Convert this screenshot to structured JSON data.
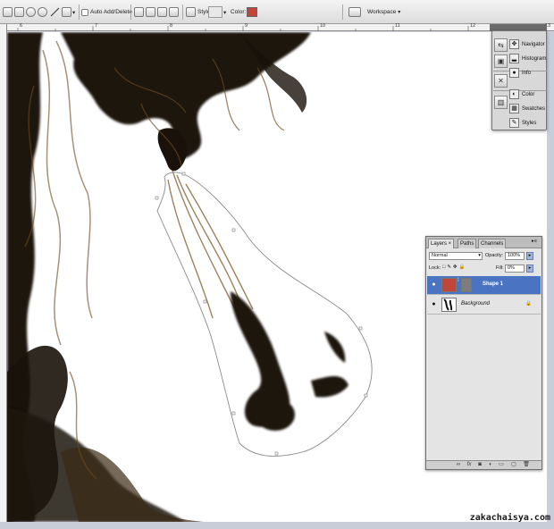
{
  "options_bar": {
    "auto_add_delete": "Auto Add/Delete",
    "style_label": "Style:",
    "color_label": "Color:",
    "color_value": "#c2453a",
    "workspace_label": "Workspace"
  },
  "ruler": {
    "h_marks": [
      "6",
      "7",
      "8",
      "9",
      "10",
      "11",
      "12",
      "13"
    ]
  },
  "dock": {
    "items": [
      {
        "label": "Navigator",
        "icon": "navigator-icon"
      },
      {
        "label": "Histogram",
        "icon": "histogram-icon"
      },
      {
        "label": "Info",
        "icon": "info-icon"
      },
      {
        "label": "Color",
        "icon": "color-icon"
      },
      {
        "label": "Swatches",
        "icon": "swatches-icon"
      },
      {
        "label": "Styles",
        "icon": "styles-icon"
      }
    ]
  },
  "layers_panel": {
    "tabs": [
      "Layers ×",
      "Paths",
      "Channels"
    ],
    "blend_mode": "Normal",
    "opacity_label": "Opacity:",
    "opacity_value": "100%",
    "lock_label": "Lock:",
    "fill_label": "Fill:",
    "fill_value": "0%",
    "layers": [
      {
        "name": "Shape 1",
        "selected": true,
        "thumb_color": "#c2453a"
      },
      {
        "name": "Background",
        "selected": false,
        "locked": true
      }
    ],
    "footer_icons": [
      "link-icon",
      "fx-icon",
      "mask-icon",
      "adjustment-icon",
      "group-icon",
      "new-layer-icon",
      "trash-icon"
    ]
  },
  "watermark": "zakachaisya.com",
  "colors": {
    "selection": "#4a73c2",
    "shape_fill": "#c2453a",
    "ink_dark": "#1a120a",
    "ink_sepia": "#6b4a22"
  }
}
